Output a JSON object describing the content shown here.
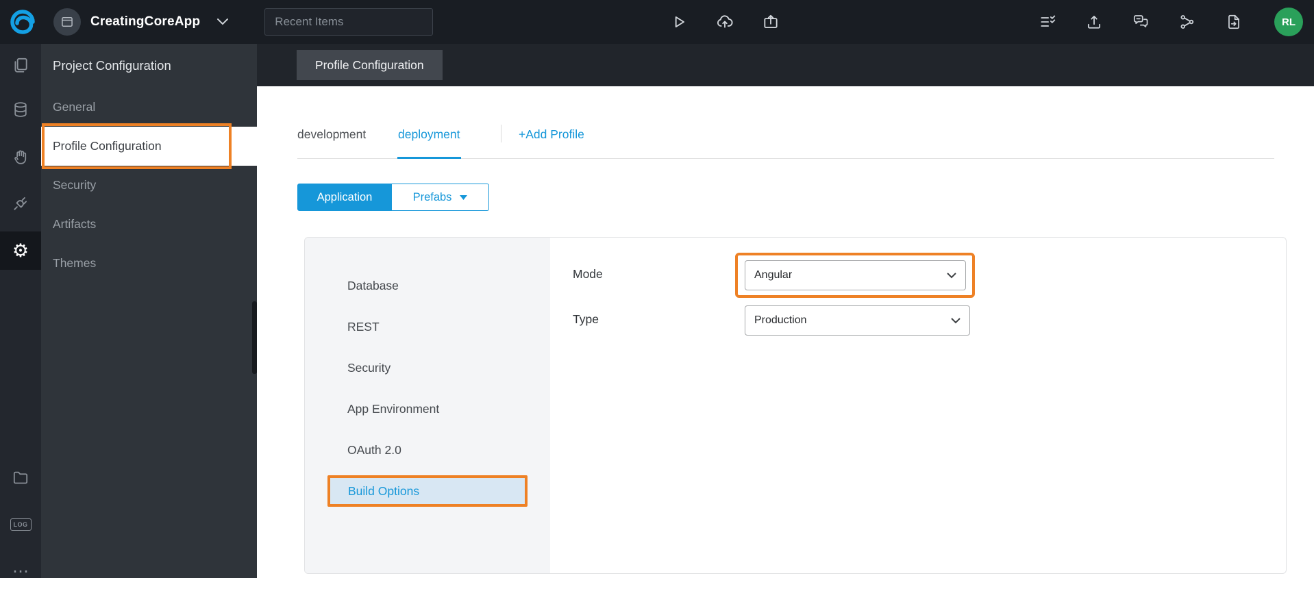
{
  "topbar": {
    "app_name": "CreatingCoreApp",
    "recent_items": {
      "placeholder": "Recent Items"
    },
    "avatar_initials": "RL"
  },
  "sidebar": {
    "title": "Project Configuration",
    "active_item": "Profile Configuration",
    "items": [
      {
        "label": "General"
      },
      {
        "label": "Profile Configuration"
      },
      {
        "label": "Security"
      },
      {
        "label": "Artifacts"
      },
      {
        "label": "Themes"
      }
    ]
  },
  "content": {
    "tab_title": "Profile Configuration",
    "profile_tabs": [
      "development",
      "deployment",
      "+Add Profile"
    ],
    "active_profile_tab": "deployment",
    "toggle": {
      "left": "Application",
      "right": "Prefabs"
    },
    "active_toggle": "Application",
    "nav": [
      "Database",
      "REST",
      "Security",
      "App Environment",
      "OAuth 2.0",
      "Build Options"
    ],
    "active_nav": "Build Options",
    "form": {
      "mode": {
        "label": "Mode",
        "value": "Angular"
      },
      "type": {
        "label": "Type",
        "value": "Production"
      }
    }
  },
  "icons": {
    "gear": "⚙",
    "log_label": "LOG",
    "more": "⋯"
  },
  "colors": {
    "accent_blue": "#1697d9",
    "highlight_orange": "#ee8125",
    "avatar_green": "#2aa05a"
  }
}
